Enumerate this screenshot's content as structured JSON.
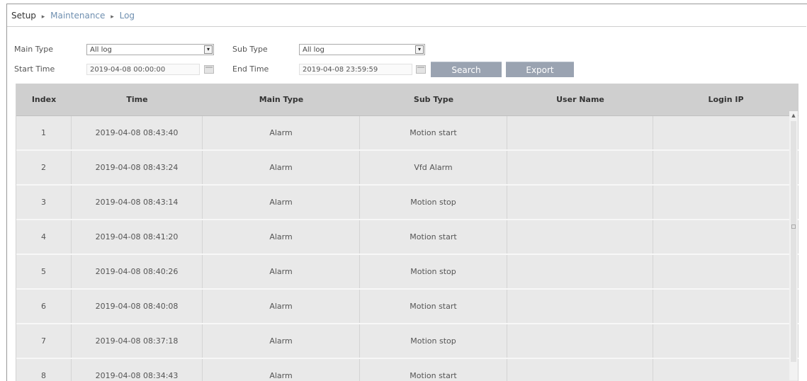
{
  "breadcrumb": {
    "items": [
      "Setup",
      "Maintenance",
      "Log"
    ],
    "separator": "▸"
  },
  "filters": {
    "main_type_label": "Main Type",
    "main_type_value": "All log",
    "sub_type_label": "Sub Type",
    "sub_type_value": "All log",
    "start_time_label": "Start Time",
    "start_time_value": "2019-04-08 00:00:00",
    "end_time_label": "End Time",
    "end_time_value": "2019-04-08 23:59:59",
    "search_label": "Search",
    "export_label": "Export"
  },
  "table": {
    "headers": [
      "Index",
      "Time",
      "Main Type",
      "Sub Type",
      "User Name",
      "Login IP"
    ],
    "rows": [
      [
        "1",
        "2019-04-08 08:43:40",
        "Alarm",
        "Motion start",
        "",
        ""
      ],
      [
        "2",
        "2019-04-08 08:43:24",
        "Alarm",
        "Vfd Alarm",
        "",
        ""
      ],
      [
        "3",
        "2019-04-08 08:43:14",
        "Alarm",
        "Motion stop",
        "",
        ""
      ],
      [
        "4",
        "2019-04-08 08:41:20",
        "Alarm",
        "Motion start",
        "",
        ""
      ],
      [
        "5",
        "2019-04-08 08:40:26",
        "Alarm",
        "Motion stop",
        "",
        ""
      ],
      [
        "6",
        "2019-04-08 08:40:08",
        "Alarm",
        "Motion start",
        "",
        ""
      ],
      [
        "7",
        "2019-04-08 08:37:18",
        "Alarm",
        "Motion stop",
        "",
        ""
      ],
      [
        "8",
        "2019-04-08 08:34:43",
        "Alarm",
        "Motion start",
        "",
        ""
      ]
    ]
  },
  "colors": {
    "button": "#9aa3b1",
    "header_bg": "#cfcfcf",
    "row_bg": "#e9e9e9",
    "breadcrumb_link": "#6f8fb0"
  },
  "icons": {
    "dropdown": "chevron-down-icon",
    "calendar": "calendar-icon",
    "scroll_up": "scroll-up-icon"
  }
}
